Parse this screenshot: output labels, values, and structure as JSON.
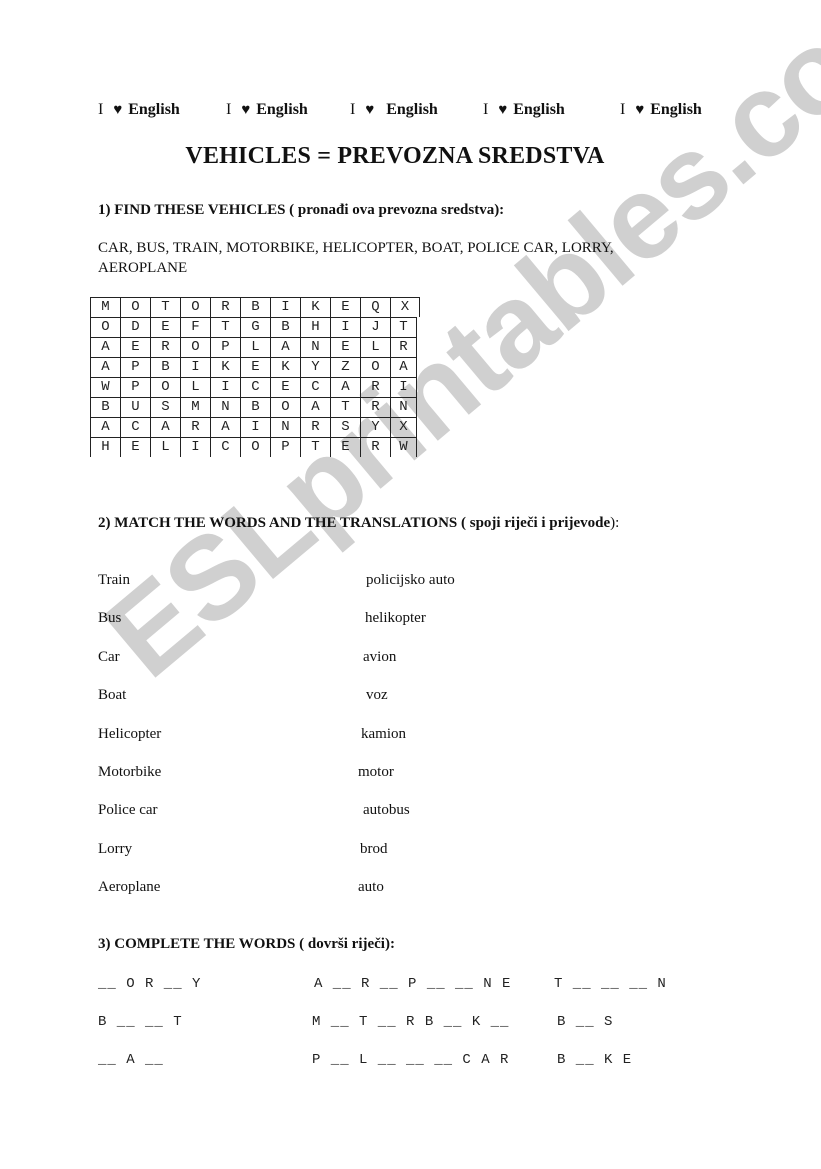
{
  "header": {
    "hearts": [
      {
        "i": "I",
        "icon": "heart-icon",
        "word": "English"
      },
      {
        "i": "I",
        "icon": "heart-icon",
        "word": "English"
      },
      {
        "i": "I",
        "icon": "heart-icon",
        "word": "English"
      },
      {
        "i": "I",
        "icon": "heart-icon",
        "word": "English"
      },
      {
        "i": "I",
        "icon": "heart-icon",
        "word": "English"
      }
    ],
    "heart_glyph": "♥",
    "title": "VEHICLES = PREVOZNA SREDSTVA"
  },
  "section1": {
    "heading": "1) FIND THESE VEHICLES",
    "heading_translation": " ( pronađi ova prevozna sredstva):",
    "word_list": "CAR, BUS, TRAIN, MOTORBIKE, HELICOPTER, BOAT, POLICE CAR, LORRY, AEROPLANE",
    "grid": [
      [
        "M",
        "O",
        "T",
        "O",
        "R",
        "B",
        "I",
        "K",
        "E",
        "Q",
        "X"
      ],
      [
        "O",
        "D",
        "E",
        "F",
        "T",
        "G",
        "B",
        "H",
        "I",
        "J",
        "T"
      ],
      [
        "A",
        "E",
        "R",
        "O",
        "P",
        "L",
        "A",
        "N",
        "E",
        "L",
        "R"
      ],
      [
        "A",
        "P",
        "B",
        "I",
        "K",
        "E",
        "K",
        "Y",
        "Z",
        "O",
        "A"
      ],
      [
        "W",
        "P",
        "O",
        "L",
        "I",
        "C",
        "E",
        "C",
        "A",
        "R",
        "I"
      ],
      [
        "B",
        "U",
        "S",
        "M",
        "N",
        "B",
        "O",
        "A",
        "T",
        "R",
        "N"
      ],
      [
        "A",
        "C",
        "A",
        "R",
        "A",
        "I",
        "N",
        "R",
        "S",
        "Y",
        "X"
      ],
      [
        "H",
        "E",
        "L",
        "I",
        "C",
        "O",
        "P",
        "T",
        "E",
        "R",
        "W"
      ]
    ]
  },
  "section2": {
    "heading": "2) MATCH THE WORDS AND THE TRANSLATIONS",
    "heading_translation": " ( spoji riječi i prijevode",
    "heading_end": "):",
    "pairs": [
      {
        "en": "Train",
        "tr": "policijsko auto"
      },
      {
        "en": "Bus",
        "tr": "helikopter"
      },
      {
        "en": "Car",
        "tr": "avion"
      },
      {
        "en": "Boat",
        "tr": "voz"
      },
      {
        "en": "Helicopter",
        "tr": "kamion"
      },
      {
        "en": "Motorbike",
        "tr": "motor"
      },
      {
        "en": "Police car",
        "tr": "autobus"
      },
      {
        "en": "Lorry",
        "tr": "brod"
      },
      {
        "en": "Aeroplane",
        "tr": "auto"
      }
    ]
  },
  "section3": {
    "heading": "3) COMPLETE THE WORDS",
    "heading_translation": " ( dovrši riječi):",
    "rows": [
      [
        "__ O R __ Y",
        "A __ R __ P __ __ N E",
        "T __ __ __ N"
      ],
      [
        "B __ __ T",
        "M __ T __ R B __ K __",
        "B __ S"
      ],
      [
        "__ A __",
        "P __ L __ __ __ C A R",
        "B __ K E"
      ]
    ]
  },
  "watermark": "ESLprintables.com"
}
